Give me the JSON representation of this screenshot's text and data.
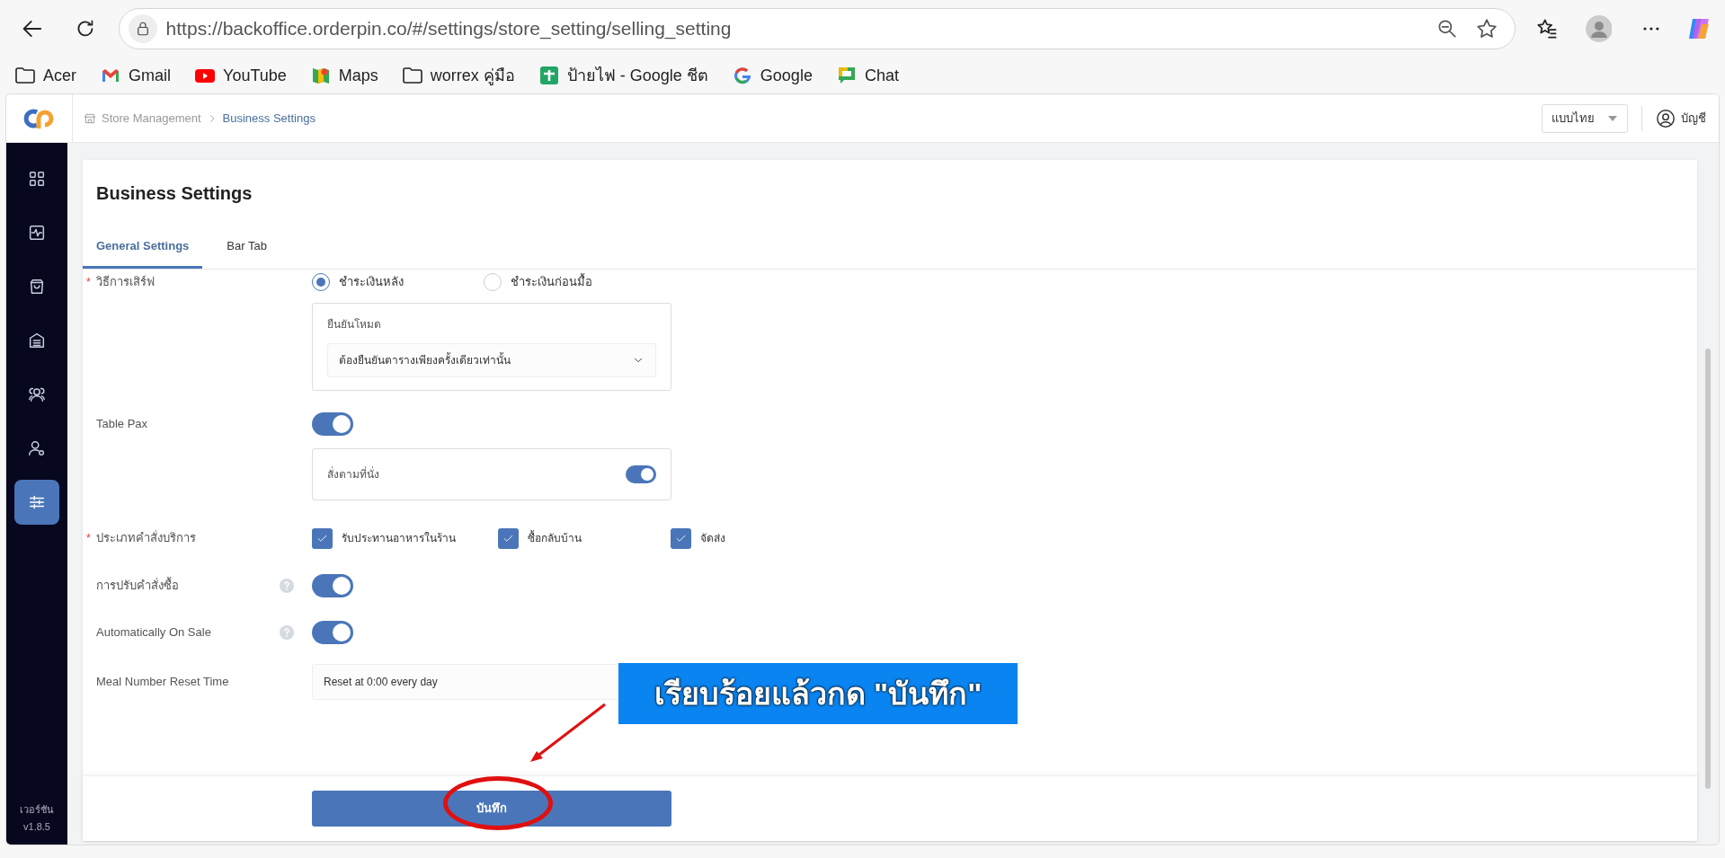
{
  "browser": {
    "url": "https://backoffice.orderpin.co/#/settings/store_setting/selling_setting",
    "bookmarks": [
      {
        "label": "Acer",
        "kind": "folder"
      },
      {
        "label": "Gmail",
        "kind": "mail"
      },
      {
        "label": "YouTube",
        "kind": "video"
      },
      {
        "label": "Maps",
        "kind": "map"
      },
      {
        "label": "worrex คู่มือ",
        "kind": "folder"
      },
      {
        "label": "ป้ายไฟ - Google ชีต",
        "kind": "sheet"
      },
      {
        "label": "Google",
        "kind": "search"
      },
      {
        "label": "Chat",
        "kind": "chat"
      }
    ]
  },
  "header": {
    "breadcrumb": [
      "Store Management",
      "Business Settings"
    ],
    "language": "แบบไทย",
    "account": "บัญชี"
  },
  "sidebar": {
    "items": [
      {
        "kind": "grid",
        "selected": false
      },
      {
        "kind": "activity",
        "selected": false
      },
      {
        "kind": "bag",
        "selected": false
      },
      {
        "kind": "archive",
        "selected": false
      },
      {
        "kind": "users",
        "selected": false
      },
      {
        "kind": "user-gear",
        "selected": false
      },
      {
        "kind": "sliders",
        "selected": true
      }
    ],
    "version_label": "เวอร์ชัน",
    "version": "v1.8.5"
  },
  "page_title": "Business Settings",
  "tabs": [
    {
      "label": "General Settings",
      "selected": true
    },
    {
      "label": "Bar Tab",
      "selected": false
    }
  ],
  "form": [
    {
      "kind": "radio",
      "label": "วิธีการเสิร์ฟ",
      "mark": "*",
      "options": [
        {
          "label": "ชำระเงินหลัง",
          "selected": true
        },
        {
          "label": "ชำระเงินก่อนมื้อ",
          "selected": false
        }
      ],
      "sub": {
        "label": "ยืนยันโหมด",
        "value": "ต้องยืนยันตารางเพียงครั้งเดียวเท่านั้น"
      }
    },
    {
      "kind": "toggle",
      "label": "Table Pax",
      "help": false,
      "on": true,
      "sub": {
        "label": "สั่งตามที่นั่ง",
        "on": true
      }
    },
    {
      "kind": "checkbox",
      "label": "ประเภทคำสั่งบริการ",
      "mark": "*",
      "options": [
        {
          "label": "รับประทานอาหารในร้าน",
          "checked": true
        },
        {
          "label": "ซื้อกลับบ้าน",
          "checked": true
        },
        {
          "label": "จัดส่ง",
          "checked": true
        }
      ]
    },
    {
      "kind": "toggle",
      "label": "การปรับคำสั่งซื้อ",
      "help": true,
      "on": true
    },
    {
      "kind": "toggle",
      "label": "Automatically On Sale",
      "help": true,
      "on": true
    },
    {
      "kind": "text",
      "label": "Meal Number Reset Time",
      "value": "Reset at 0:00 every day"
    }
  ],
  "save_button": "บันทึก",
  "annotation": {
    "text": "เรียบร้อยแล้วกด \"บันทึก\""
  }
}
